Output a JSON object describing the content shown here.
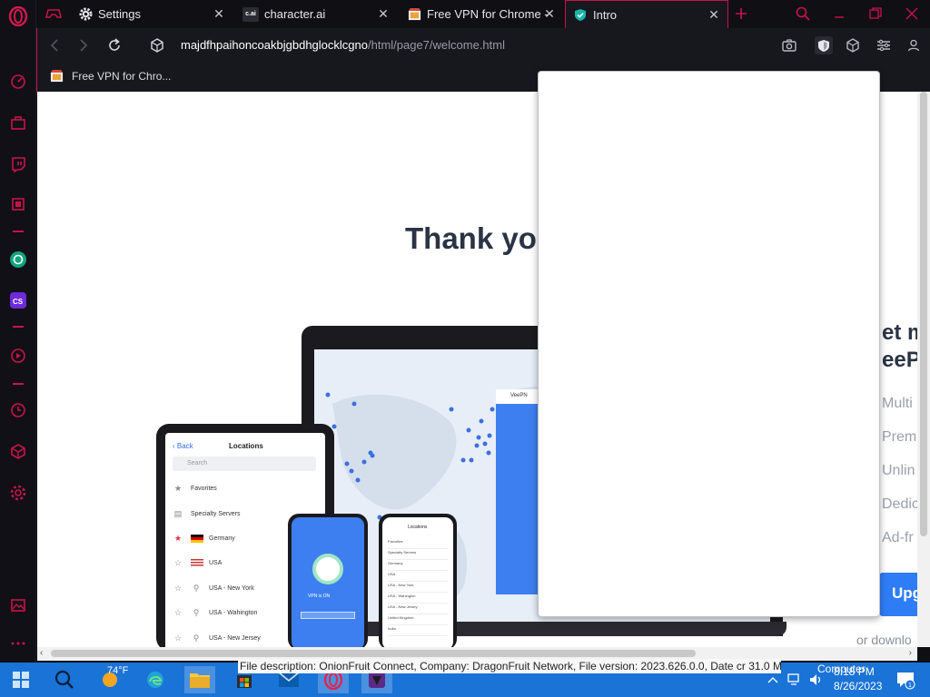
{
  "tabs": [
    {
      "label": "Settings",
      "icon": "gear-icon"
    },
    {
      "label": "character.ai",
      "icon": "character-ai-icon",
      "favicon_text": "c.ai"
    },
    {
      "label": "Free VPN for Chrome - ",
      "icon": "vpn-store-icon"
    },
    {
      "label": "Intro",
      "icon": "shield-icon",
      "active": true
    }
  ],
  "address": {
    "host": "majdfhpaihoncoakbjgbdhglocklcgno",
    "path": "/html/page7/welcome.html"
  },
  "bookmarks": [
    {
      "label": "Free VPN for Chro..."
    }
  ],
  "page": {
    "headline": "Thank you",
    "right_fragments": {
      "line1": "et m",
      "line2": "eePN",
      "features": [
        "Multi",
        "Prem",
        "Unlin",
        "Dedic",
        "Ad-fr"
      ]
    },
    "upgrade_button": "Upg",
    "download_text": "or downlo",
    "tablet": {
      "back": "Back",
      "title": "Locations",
      "search_placeholder": "Search",
      "rows": [
        "Favorites",
        "Specialty Servers",
        "Germany",
        "USA",
        "USA - New York",
        "USA - Wahington",
        "USA - New Jersey"
      ]
    },
    "phone_vpn_label": "VPN is ON",
    "phone_locations": {
      "title": "Locations",
      "rows": [
        "Favorites",
        "Specialty Servers",
        "Germany",
        "USA",
        "USA - New York",
        "USA - Wahington",
        "USA - New Jersey",
        "United Kingdom",
        "India"
      ]
    },
    "panel_title": "VeePN"
  },
  "status_tooltip": "File description: OnionFruit Connect, Company: DragonFruit Network, File version: 2023.626.0.0, Date cr  31.0 MB",
  "taskbar": {
    "weather": "74°F",
    "computer_label": "Computer",
    "time": "8:18 PM",
    "date": "8/26/2023",
    "notifications": "1"
  },
  "colors": {
    "accent": "#c9134a",
    "vpn_blue": "#3d7ff0",
    "taskbar": "#1a73d6"
  }
}
